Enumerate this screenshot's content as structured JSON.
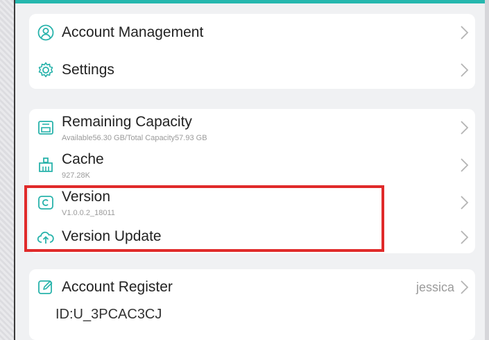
{
  "colors": {
    "accent": "#25b7ae",
    "highlight": "#e02a2a"
  },
  "groups": {
    "account": {
      "items": [
        {
          "label": "Account Management",
          "icon": "user-circle-icon"
        },
        {
          "label": "Settings",
          "icon": "gear-icon"
        }
      ]
    },
    "storage": {
      "items": [
        {
          "label": "Remaining Capacity",
          "sub": "Available56.30 GB/Total Capacity57.93 GB",
          "icon": "storage-icon"
        },
        {
          "label": "Cache",
          "sub": "927.28K",
          "icon": "broom-icon"
        },
        {
          "label": "Version",
          "sub": "V1.0.0.2_18011",
          "icon": "copyright-icon"
        },
        {
          "label": "Version Update",
          "icon": "cloud-upload-icon"
        }
      ]
    },
    "register": {
      "label": "Account Register",
      "value": "jessica",
      "id_text": "ID:U_3PCAC3CJ",
      "icon": "edit-icon"
    }
  }
}
